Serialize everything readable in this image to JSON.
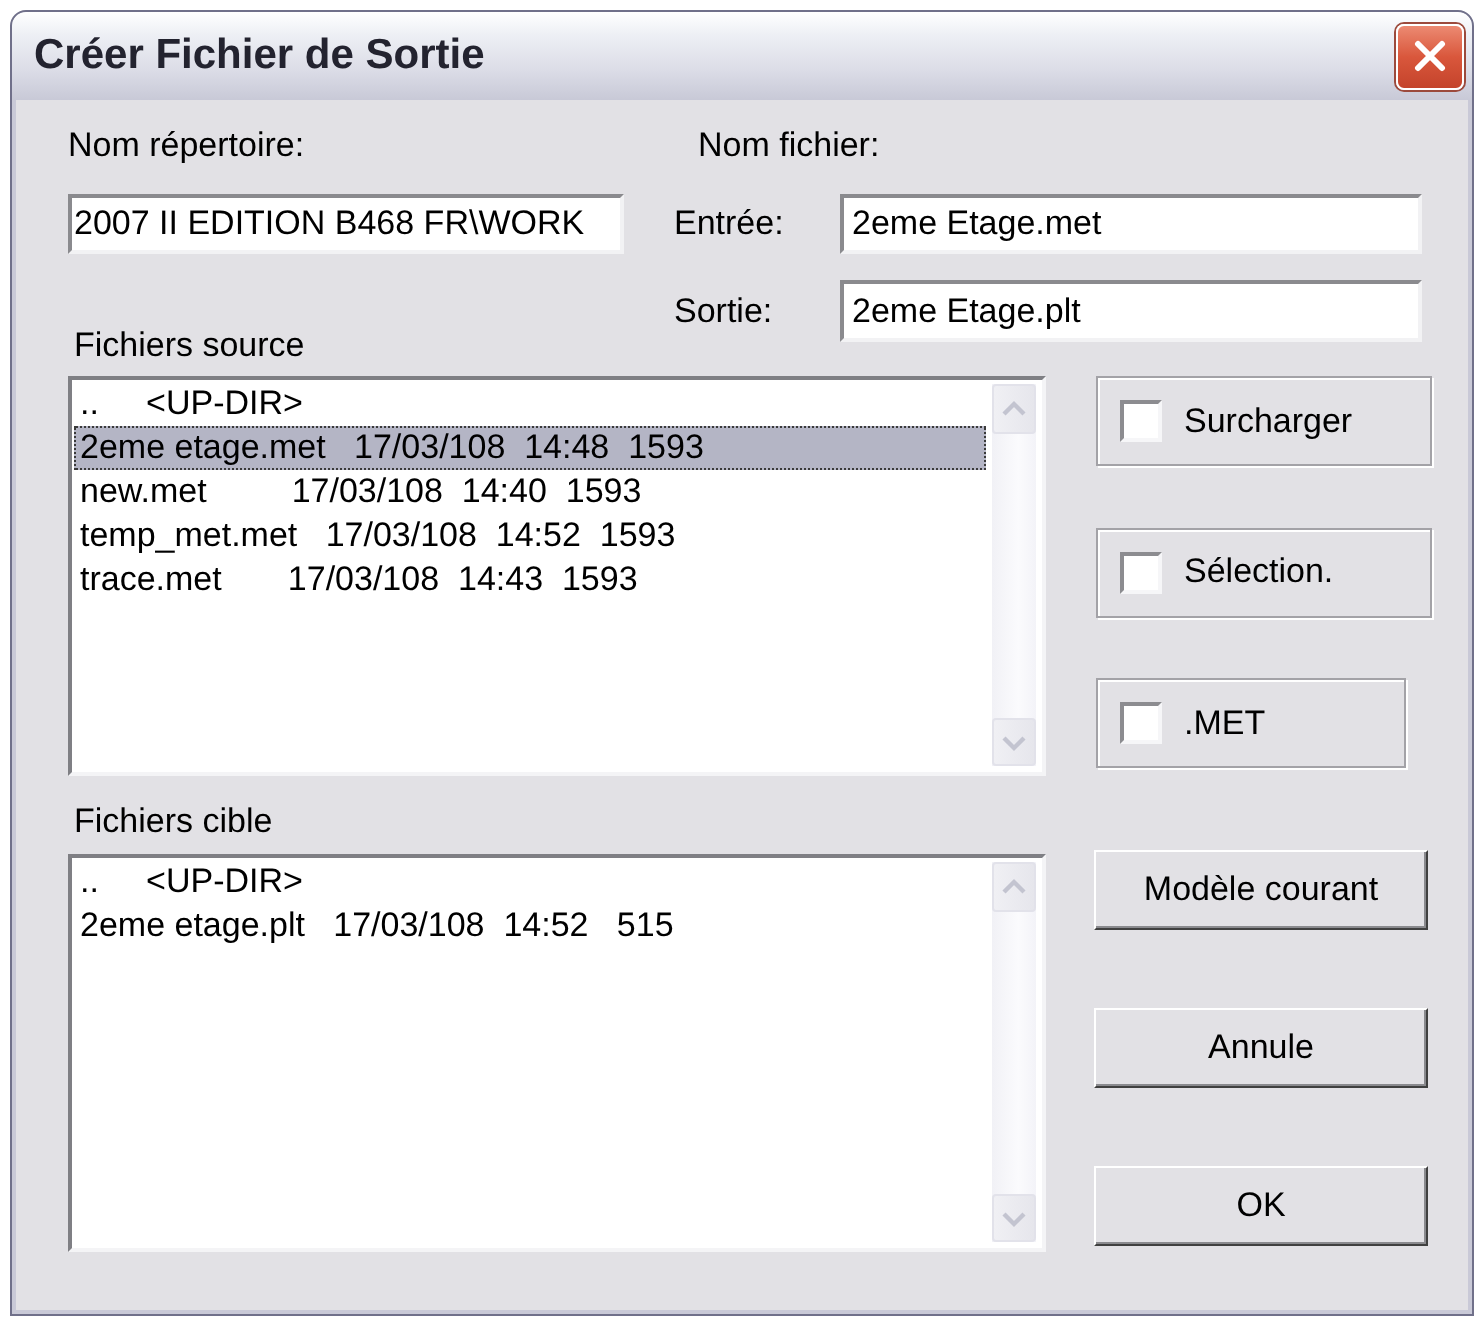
{
  "window": {
    "title": "Créer Fichier de Sortie"
  },
  "directory": {
    "label": "Nom répertoire:",
    "value": "2007 II EDITION B468 FR\\WORK"
  },
  "file_name": {
    "label": "Nom fichier:",
    "input": {
      "label": "Entrée:",
      "value": "2eme Etage.met"
    },
    "output": {
      "label": "Sortie:",
      "value": "2eme Etage.plt"
    }
  },
  "source_files": {
    "label": "Fichiers source",
    "rows": [
      {
        "text": "..     <UP-DIR>",
        "selected": false
      },
      {
        "text": "2eme etage.met   17/03/108  14:48  1593",
        "selected": true
      },
      {
        "text": "new.met         17/03/108  14:40  1593",
        "selected": false
      },
      {
        "text": "temp_met.met   17/03/108  14:52  1593",
        "selected": false
      },
      {
        "text": "trace.met       17/03/108  14:43  1593",
        "selected": false
      }
    ]
  },
  "options": [
    {
      "label": "Surcharger",
      "checked": false
    },
    {
      "label": "Sélection.",
      "checked": false
    },
    {
      "label": ".MET",
      "checked": false
    }
  ],
  "target_files": {
    "label": "Fichiers cible",
    "rows": [
      {
        "text": "..     <UP-DIR>",
        "selected": false
      },
      {
        "text": "2eme etage.plt   17/03/108  14:52   515",
        "selected": false
      }
    ]
  },
  "buttons": [
    "Modèle courant",
    "Annule",
    "OK"
  ]
}
